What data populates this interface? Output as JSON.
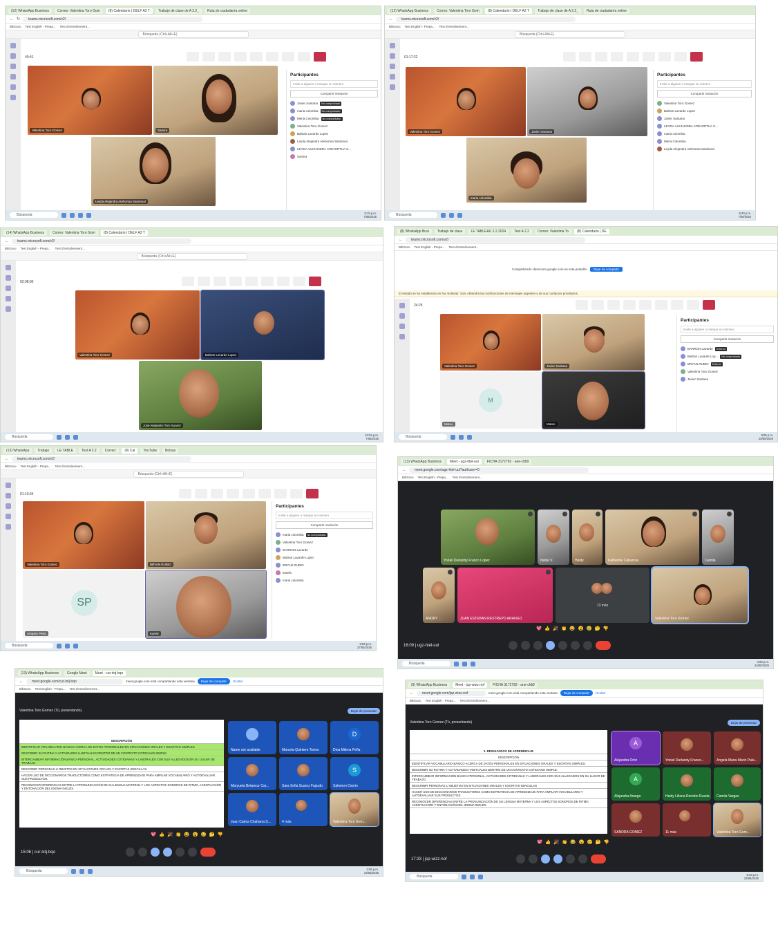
{
  "colors": {
    "teams_accent": "#6264a7",
    "meet_bg": "#202124",
    "meet_blue": "#8ab4f8",
    "leave_red": "#c4314b",
    "highlight": "#a5e86a"
  },
  "shots": [
    {
      "tabs": [
        "(12) WhatsApp Business",
        "Correo: Valentina Toro Gom",
        "(8) Calendario | DELF A2 T",
        "Trabajo de clase de A 2.2_",
        "Ruta de ciudadanía online"
      ],
      "url": "teams.microsoft.com/v2/",
      "search": "Búsqueda (Ctrl+Alt+E)",
      "timer": "49:41",
      "tiles": [
        "Valentina Toro Gomez",
        "Samira",
        "Leyda Alejandra Atehortua Sandoval"
      ],
      "panel": {
        "title": "Participantes",
        "input": "Invite a alguien o marque un número",
        "invite": "Compartir invitación",
        "rows": [
          {
            "n": "Javier Santana",
            "b": "No comprobado"
          },
          {
            "n": "maria colombia",
            "b": "No comprobado"
          },
          {
            "n": "Meria Colombia",
            "b": "No comprobado"
          },
          {
            "n": "Valentina Toro Gomez",
            "b": ""
          },
          {
            "n": "Baltran Lavarde Lopez",
            "b": ""
          },
          {
            "n": "Leyda Alejandra Atehortua Sandoval",
            "b": ""
          },
          {
            "n": "LEYDA ALEJANDRA ATEHORTUA S...",
            "b": ""
          },
          {
            "n": "Samira",
            "b": ""
          }
        ]
      },
      "clock": [
        "8:15 p.m.",
        "7/06/2025"
      ]
    },
    {
      "tabs": [
        "(12) WhatsApp Business",
        "Correo: Valentina Toro Gom",
        "(8) Calendario | DELF A2 T",
        "Trabajo de clase de A 2.2_",
        "Ruta de ciudadanía online"
      ],
      "url": "teams.microsoft.com/v2/",
      "search": "Búsqueda (Ctrl+Alt+E)",
      "timer": "01:17:22",
      "tiles": [
        "Valentina Toro Gomez",
        "Javier Santana",
        "maria colombia"
      ],
      "panel": {
        "title": "Participantes",
        "input": "Invite a alguien o marque un número",
        "invite": "Compartir invitación",
        "rows": [
          {
            "n": "Valentina Toro Gomez",
            "b": ""
          },
          {
            "n": "Baltran Lavarde Lopez",
            "b": ""
          },
          {
            "n": "Javier Santana",
            "b": ""
          },
          {
            "n": "LEYDA ALEJANDRA ATEHORTUA S...",
            "b": ""
          },
          {
            "n": "maria colombia",
            "b": ""
          },
          {
            "n": "Meria Colombia",
            "b": ""
          },
          {
            "n": "Leyda Alejandra Atehortua Sandoval",
            "b": ""
          }
        ]
      },
      "clock": [
        "8:40 p.m.",
        "7/06/2025"
      ]
    },
    {
      "tabs": [
        "(14) WhatsApp Business",
        "Correo: Valentina Toro Gom",
        "(8) Calendario | DELF A2 T"
      ],
      "url": "teams.microsoft.com/v2/",
      "search": "Búsqueda (Ctrl+Alt+E)",
      "timer": "02:08:00",
      "tiles": [
        "Valentina Toro Gomez",
        "Baltran Lavarde Lopez",
        "José Alejandro Toro Suarez"
      ],
      "clock": [
        "10:04 p.m.",
        "7/06/2025"
      ]
    },
    {
      "tabs": [
        "(8) WhatsApp Busi",
        "Trabajo de clase",
        "LE TABLEAU 2.2 2024",
        "Test A 2.2",
        "Correo: Valentina To",
        "(8) Calendario | DE"
      ],
      "url": "teams.microsoft.com/v2/",
      "share": "Compartiendo classroom.google.com en esta pestaña",
      "stopshare": "Dejar de compartir",
      "notice": "El estado se ha establecido en No molestar. Solo obtendrá las notificaciones de mensajes urgentes y de sus contactos prioritarios.",
      "timer": "24:25",
      "tiles": [
        "Valentina Toro Gomez",
        "Javier Santana",
        "M",
        "Mateo"
      ],
      "panel": {
        "title": "Participantes",
        "input": "Invite a alguien o marque un número",
        "invite": "Compartir invitación",
        "rows": [
          {
            "n": "BARRON Lavarde",
            "b": "Externo"
          },
          {
            "n": "Baltran Lavarde Lop...",
            "b": "No comprobado"
          },
          {
            "n": "BRYAN RUBIO",
            "b": "Externo"
          },
          {
            "n": "Valentina Toro Gomez",
            "b": ""
          },
          {
            "n": "Javier Santana",
            "b": ""
          }
        ]
      },
      "clock": [
        "8:05 p.m.",
        "28/05/2025"
      ]
    },
    {
      "tabs": [
        "(13) WhatsApp",
        "Trabajo",
        "LE TABLE",
        "Test A 2.2",
        "Correo:",
        "(8) Cal",
        "YouTube",
        "Bolsas"
      ],
      "url": "teams.microsoft.com/v2/",
      "search": "Búsqueda (Ctrl+Alt+E)",
      "timer": "01:10:34",
      "tiles": [
        "Valentina Toro Gomez",
        "BRYAN RUBIO",
        "SP",
        "Amparo Peña",
        "Karely"
      ],
      "panel": {
        "title": "Participantes",
        "input": "Invite a alguien o marque un número",
        "invite": "Compartir invitación",
        "rows": [
          {
            "n": "maria colombia",
            "b": "No comprobado"
          },
          {
            "n": "Valentina Toro Gomez",
            "b": ""
          },
          {
            "n": "BARRON Lavarde",
            "b": ""
          },
          {
            "n": "Baltran Lavarde Lopez",
            "b": ""
          },
          {
            "n": "BRYAN RUBIO",
            "b": ""
          },
          {
            "n": "Estefa",
            "b": ""
          },
          {
            "n": "maria colombia",
            "b": ""
          }
        ]
      },
      "clock": [
        "8:56 p.m.",
        "27/05/2025"
      ]
    },
    {
      "tabs": [
        "(13) WhatsApp Business",
        "Meet - ugz-htel-uul",
        "FICHA 3172782 - ane-cfdi9"
      ],
      "url": "meet.google.com/ugz-htel-uul?authuser=0",
      "tiles": [
        "Yoniel Durlandy Franco Lopez",
        "Natali V.",
        "Heidy",
        "Katherine Cabarcas",
        "Camila",
        "ANDRY ...",
        "JUAN ESTEBAN RESTREPO ARANGO",
        "13 más",
        "Valentina Toro Gomez"
      ],
      "code": "16:09 | ugz-htel-uul",
      "clock": [
        "4:09 p.m.",
        "24/05/2025"
      ]
    },
    {
      "tabs": [
        "(13) WhatsApp Business",
        "Google Meet",
        "Meet - cur-txtj-bqo"
      ],
      "url": "meet.google.com/cur-txtj-bqo",
      "share": "meet.google.com está compartiendo esta ventana",
      "stopshare": "Dejar de compartir",
      "hide": "Ocultar",
      "presenter": "Valentina Toro Gomez (Tú, presentando)",
      "stoppres": "Dejar de presentar",
      "doc": {
        "head": "DESCRIPCIÓN",
        "rows": [
          "IDENTIFICAR VOCABULARIO BÁSICO ACERCA DE DATOS PERSONALES EN SITUACIONES ORALES Y ESCRITAS SIMPLES.",
          "DESCRIBIR SU RUTINA Y ACTIVIDADES HABITUALES DENTRO DE UN CONTEXTO COTIDIANO SIMPLE.",
          "INTERCAMBIAR INFORMACIÓN BÁSICA PERSONAL, ACTIVIDADES COTIDIANAS Y LABORALES CON SUS ALLEGADOS EN SU LUGAR DE TRABAJO.",
          "DESCRIBIR PERSONAS U OBJETOS EN SITUACIONES ORALES Y ESCRITAS SENCILLAS.",
          "HACER USO DE DICCIONARIOS TRADUCTORES COMO ESTRATEGIA DE APRENDIZAJE PARA AMPLIAR VOCABULARIO Y AUTOEVALUAR SUS PRODUCTOS.",
          "RECONOCER DIFERENCIAS ENTRE LA PRONUNCIACIÓN DE SU LENGUA MATERNA Y LOS ASPECTOS SONOROS DE RITMO, ACENTUACIÓN Y ENTONACIÓN DEL IDIOMA INGLÉS."
        ]
      },
      "tiles": [
        "Name not available",
        "Marcela Quintero Torres",
        "Dina Milena Peña",
        "Maryuela Betancur Car...",
        "Sara Sofia Suarez Fajardo",
        "Salomon Osorio",
        "Juan Carlos Chaharra S...",
        "4 más",
        "Valentina Toro Gom..."
      ],
      "code": "15:06 | cur-txtj-bqo",
      "clock": [
        "3:06 p.m.",
        "24/05/2025"
      ]
    },
    {
      "tabs": [
        "(9) WhatsApp Business",
        "Meet - jsp-wizz-nof",
        "FICHA 3172782 - ane-cfdi9"
      ],
      "url": "meet.google.com/jsp-wizz-nof",
      "share": "meet.google.com está compartiendo esta ventana",
      "stopshare": "Dejar de compartir",
      "hide": "Ocultar",
      "presenter": "Valentina Toro Gomez (Tú, presentando)",
      "stoppres": "Dejar de presentar",
      "doc": {
        "head": "2. RESULTADOS DE APRENDIZAJE",
        "sub": "DESCRIPCIÓN",
        "rows": [
          "IDENTIFICAR VOCABULARIO BÁSICO ACERCA DE DATOS PERSONALES EN SITUACIONES ORALES Y ESCRITAS SIMPLES.",
          "DESCRIBIR SU RUTINA Y ACTIVIDADES HABITUALES DENTRO DE UN CONTEXTO COTIDIANO SIMPLE.",
          "INTERCAMBIAR INFORMACIÓN BÁSICA PERSONAL, ACTIVIDADES COTIDIANAS Y LABORALES CON SUS ALLEGADOS EN SU LUGAR DE TRABAJO.",
          "DESCRIBIR PERSONAS U OBJETOS EN SITUACIONES ORALES Y ESCRITAS SENCILLAS.",
          "HACER USO DE DICCIONARIOS TRADUCTORES COMO ESTRATEGIA DE APRENDIZAJE PARA AMPLIAR VOCABULARIO Y AUTOEVALUAR SUS PRODUCTOS.",
          "RECONOCER DIFERENCIAS ENTRE LA PRONUNCIACIÓN DE SU LENGUA MATERNA Y LOS ASPECTOS SONOROS DE RITMO, ACENTUACIÓN Y ENTONACIÓN DEL IDIOMA INGLÉS."
        ]
      },
      "tiles": [
        "Alejandra Ortiz",
        "Yoniel Durlandy Franco...",
        "Angela Maria Marin Pala...",
        "Alejandra Arango",
        "Heidy Liliana Rendon Rueda",
        "Camila Vargas",
        "SANDRA GOMEZ",
        "11 más",
        "Valentina Toro Gom..."
      ],
      "code": "17:33 | jsp-wizz-nof",
      "clock": [
        "5:33 p.m.",
        "26/05/2025"
      ]
    }
  ],
  "bookmarks": [
    "BibGuru",
    "Test English - Prepa...",
    "Test d'entraînement...",
    "Todos los marcadores"
  ],
  "taskbar_search": "Búsqueda",
  "reactions": [
    "💖",
    "👍",
    "🎉",
    "👏",
    "😂",
    "😮",
    "😢",
    "🤔",
    "👎"
  ]
}
